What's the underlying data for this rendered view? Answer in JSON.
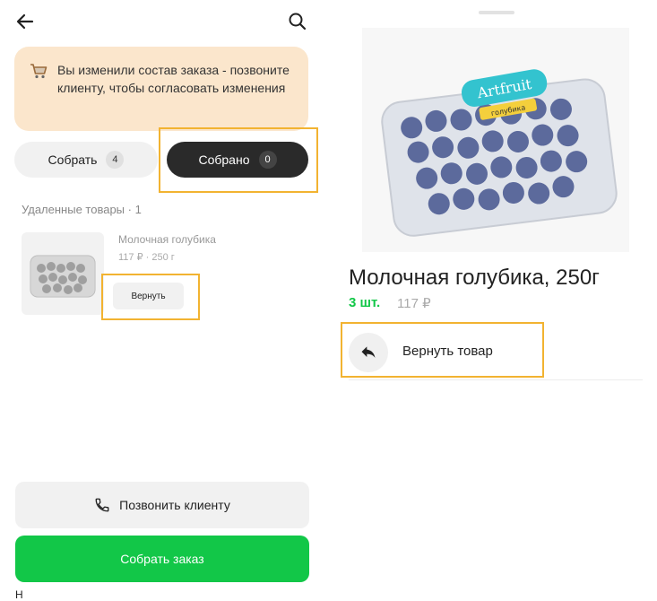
{
  "left": {
    "header": {
      "back_icon": "arrow-left-icon",
      "search_icon": "search-icon"
    },
    "notice": {
      "icon": "cart-icon",
      "text": "Вы изменили состав заказа - позвоните клиенту, чтобы согласовать изменения"
    },
    "tabs": [
      {
        "label": "Собрать",
        "count": "4",
        "active": false
      },
      {
        "label": "Собрано",
        "count": "0",
        "active": true
      }
    ],
    "removed_section": {
      "title": "Удаленные товары · 1"
    },
    "removed_item": {
      "name": "Молочная голубика",
      "meta": "117 ₽  ·  250 г",
      "return_label": "Вернуть"
    },
    "actions": {
      "call_label": "Позвонить клиенту",
      "submit_label": "Собрать заказ"
    },
    "cut_text": "Н"
  },
  "right": {
    "product": {
      "title": "Молочная голубика, 250г",
      "qty": "3 шт.",
      "price": "117 ₽",
      "brand": "Artfruit",
      "brand_sub": "голубика"
    },
    "return_action": {
      "label": "Вернуть товар",
      "icon": "reply-arrow-icon"
    }
  },
  "colors": {
    "accent_green": "#12c748",
    "highlight": "#f2b331",
    "notice_bg": "#fbe6cc",
    "dark_tab": "#2a2a2a"
  }
}
